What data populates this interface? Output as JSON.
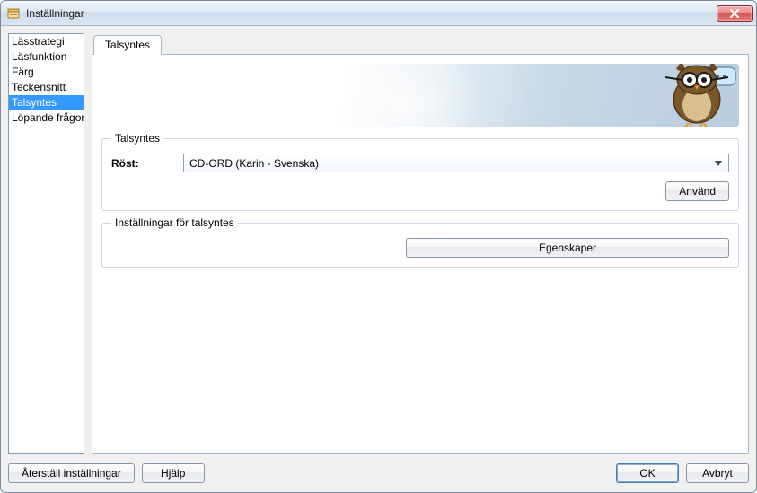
{
  "window": {
    "title": "Inställningar"
  },
  "sidebar": {
    "items": [
      {
        "label": "Lässtrategi",
        "selected": false
      },
      {
        "label": "Läsfunktion",
        "selected": false
      },
      {
        "label": "Färg",
        "selected": false
      },
      {
        "label": "Teckensnitt",
        "selected": false
      },
      {
        "label": "Talsyntes",
        "selected": true
      },
      {
        "label": "Löpande frågor",
        "selected": false
      }
    ]
  },
  "tabs": [
    {
      "label": "Talsyntes",
      "active": true
    }
  ],
  "talsyntes_group": {
    "legend": "Talsyntes",
    "voice_label": "Röst:",
    "voice_value": "CD-ORD (Karin - Svenska)",
    "apply_label": "Använd"
  },
  "settings_group": {
    "legend": "Inställningar för talsyntes",
    "properties_label": "Egenskaper"
  },
  "footer": {
    "reset_label": "Återställ inställningar",
    "help_label": "Hjälp",
    "ok_label": "OK",
    "cancel_label": "Avbryt"
  },
  "icons": {
    "close": "close-icon",
    "app": "app-icon",
    "owl": "owl-mascot-icon",
    "speech": "speech-bubble-icon",
    "chevron_down": "chevron-down-icon"
  }
}
